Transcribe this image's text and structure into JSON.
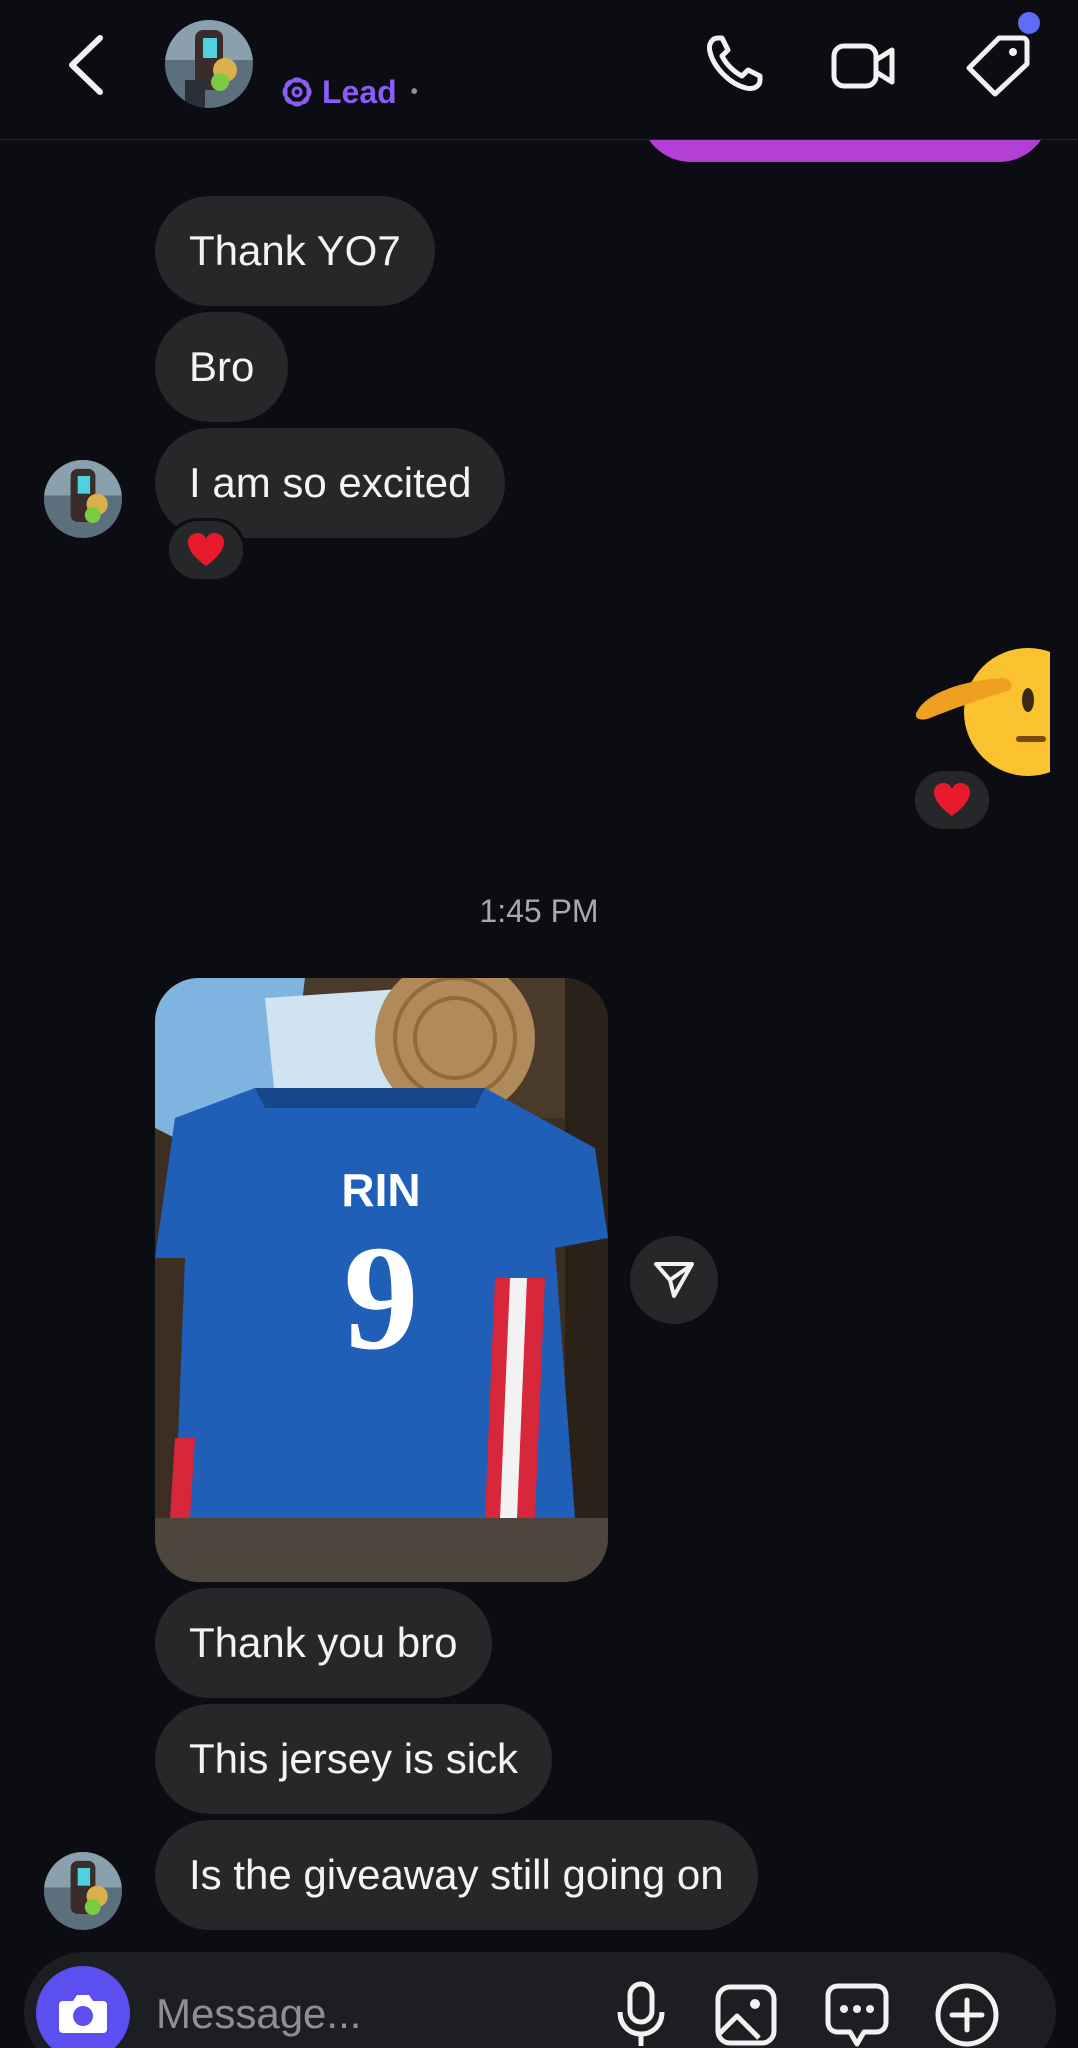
{
  "header": {
    "label": "Lead",
    "icons": [
      "back-icon",
      "avatar",
      "lead-icon",
      "phone-icon",
      "video-icon",
      "tag-icon"
    ],
    "notification_color": "#5b6ef5",
    "accent_color": "#8b5cf6"
  },
  "messages": {
    "m1": "Thank YO7",
    "m2": "Bro",
    "m3": "I am so excited",
    "m4": "Thank you bro",
    "m5": "This jersey is sick",
    "m6": "Is the giveaway still going on"
  },
  "reactions": {
    "r1": "❤️",
    "r2": "❤️"
  },
  "timestamp": "1:45 PM",
  "photo": {
    "name_on_jersey": "RIN",
    "number": "9"
  },
  "composer": {
    "placeholder": "Message...",
    "camera_color": "#5b4ff0"
  },
  "colors": {
    "sent_bubble": "#b43fd6",
    "received_bubble": "#262729"
  }
}
